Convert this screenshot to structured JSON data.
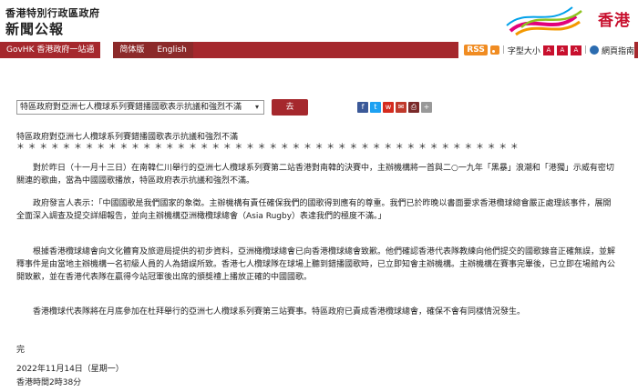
{
  "header": {
    "gov_name": "香港特別行政區政府",
    "press_title": "新聞公報",
    "brand": "香港"
  },
  "nav": {
    "items": [
      "GovHK 香港政府一站通",
      "简体版",
      "English"
    ]
  },
  "tools": {
    "rss": "RSS",
    "font_size_label": "字型大小",
    "font_a1": "A",
    "font_a2": "A",
    "font_a3": "A",
    "accessibility": "網頁指南"
  },
  "selector": {
    "selected": "特區政府對亞洲七人欖球系列賽錯播國歌表示抗議和強烈不滿"
  },
  "go_button": "去",
  "share_icons": [
    "facebook-icon",
    "twitter-icon",
    "weibo-icon",
    "email-icon",
    "print-icon",
    "more-icon"
  ],
  "article": {
    "title": "特區政府對亞洲七人欖球系列賽錯播國歌表示抗議和強烈不滿",
    "stars": "＊＊＊＊＊＊＊＊＊＊＊＊＊＊＊＊＊＊＊＊＊＊＊＊＊＊＊＊＊＊＊＊＊＊＊＊＊＊＊＊＊＊＊＊",
    "p1": "對於昨日（十一月十三日）在南韓仁川舉行的亞洲七人欖球系列賽第二站香港對南韓的決賽中，主辦機構將一首與二○一九年「黑暴」浪潮和「港獨」示威有密切關連的歌曲，當為中國國歌播放，特區政府表示抗議和強烈不滿。",
    "p2": "政府發言人表示：「中國國歌是我們國家的象徵。主辦機構有責任確保我們的國歌得到應有的尊重。我們已於昨晚以書面要求香港欖球總會嚴正處理該事件，展開全面深入調查及提交詳細報告，並向主辦機構亞洲橄欖球總會（Asia Rugby）表達我們的極度不滿。」",
    "p3": "根據香港欖球總會向文化體育及旅遊局提供的初步資料，亞洲橄欖球總會已向香港欖球總會致歉。他們確認香港代表隊教練向他們提交的國歌錄音正確無誤，並解釋事件是由當地主辦機構一名初級人員的人為錯誤所致。香港七人欖球隊在球場上聽到錯播國歌時，已立即知會主辦機構。主辦機構在賽事完畢後，已立即在場館內公開致歉，並在香港代表隊在贏得今站冠軍後出席的頒獎禮上播放正確的中國國歌。",
    "p4": "香港欖球代表隊將在月底參加在杜拜舉行的亞洲七人欖球系列賽第三站賽事。特區政府已責成香港欖球總會，確保不會有同樣情況發生。",
    "end": "完",
    "date": "2022年11月14日（星期一）",
    "time": "香港時間2時38分"
  }
}
